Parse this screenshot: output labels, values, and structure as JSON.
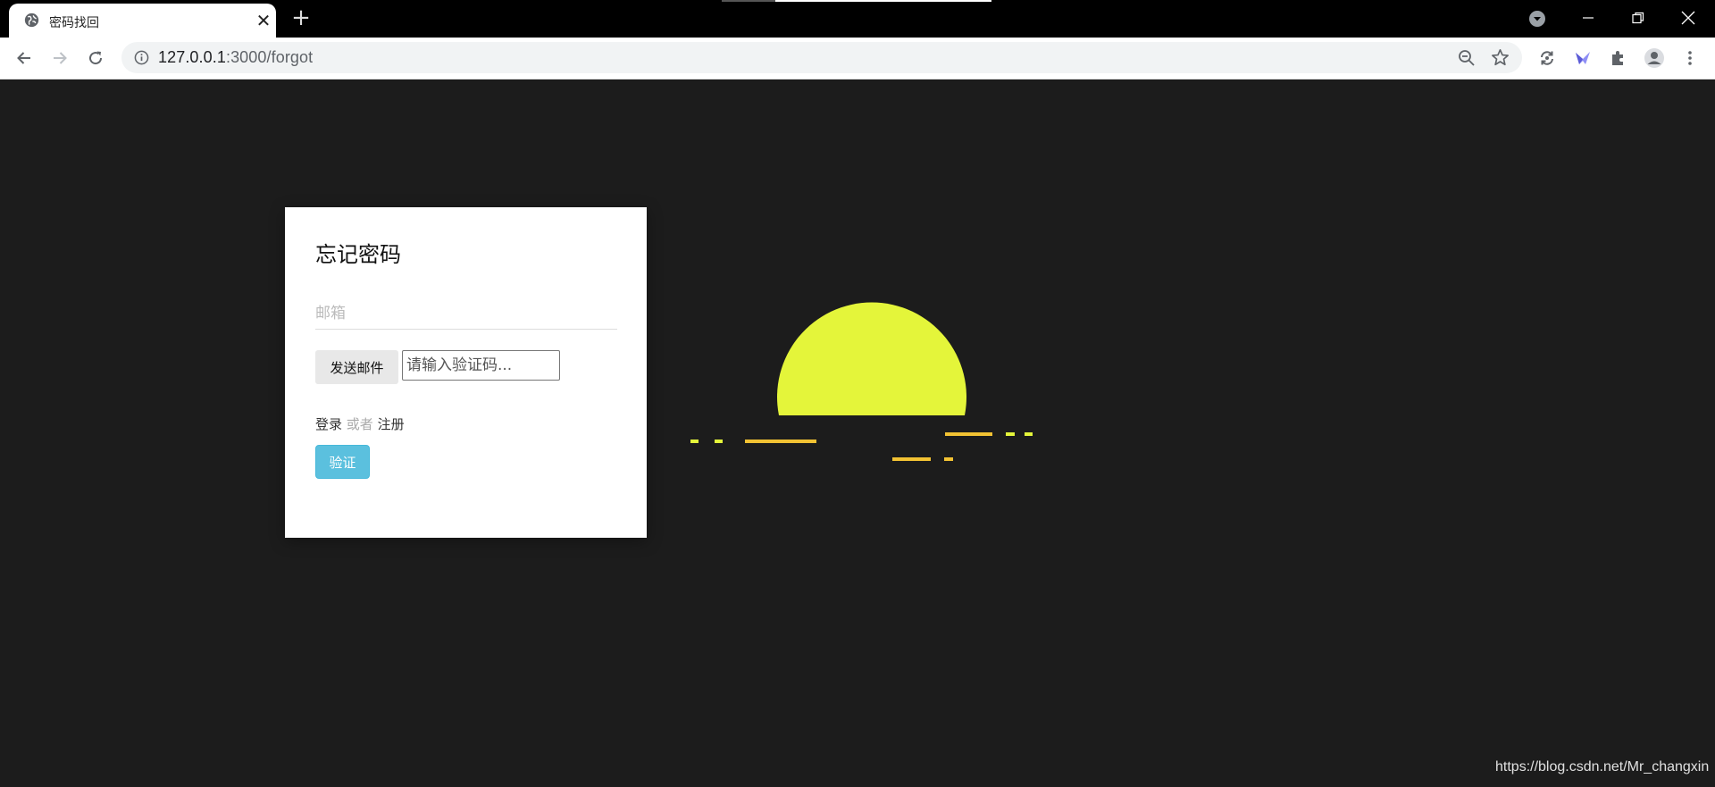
{
  "browser": {
    "tab_title": "密码找回",
    "url_host": "127.0.0.1",
    "url_path": ":3000/forgot"
  },
  "page": {
    "title": "忘记密码",
    "email_placeholder": "邮箱",
    "send_button": "发送邮件",
    "code_placeholder": "请输入验证码...",
    "login_link": "登录",
    "or_text": "或者",
    "register_link": "注册",
    "verify_button": "验证"
  },
  "watermark": "https://blog.csdn.net/Mr_changxin",
  "colors": {
    "background": "#1c1c1c",
    "sun": "#e4f53a",
    "dash_yellow": "#f2c233",
    "verify_button": "#5bc0de"
  }
}
